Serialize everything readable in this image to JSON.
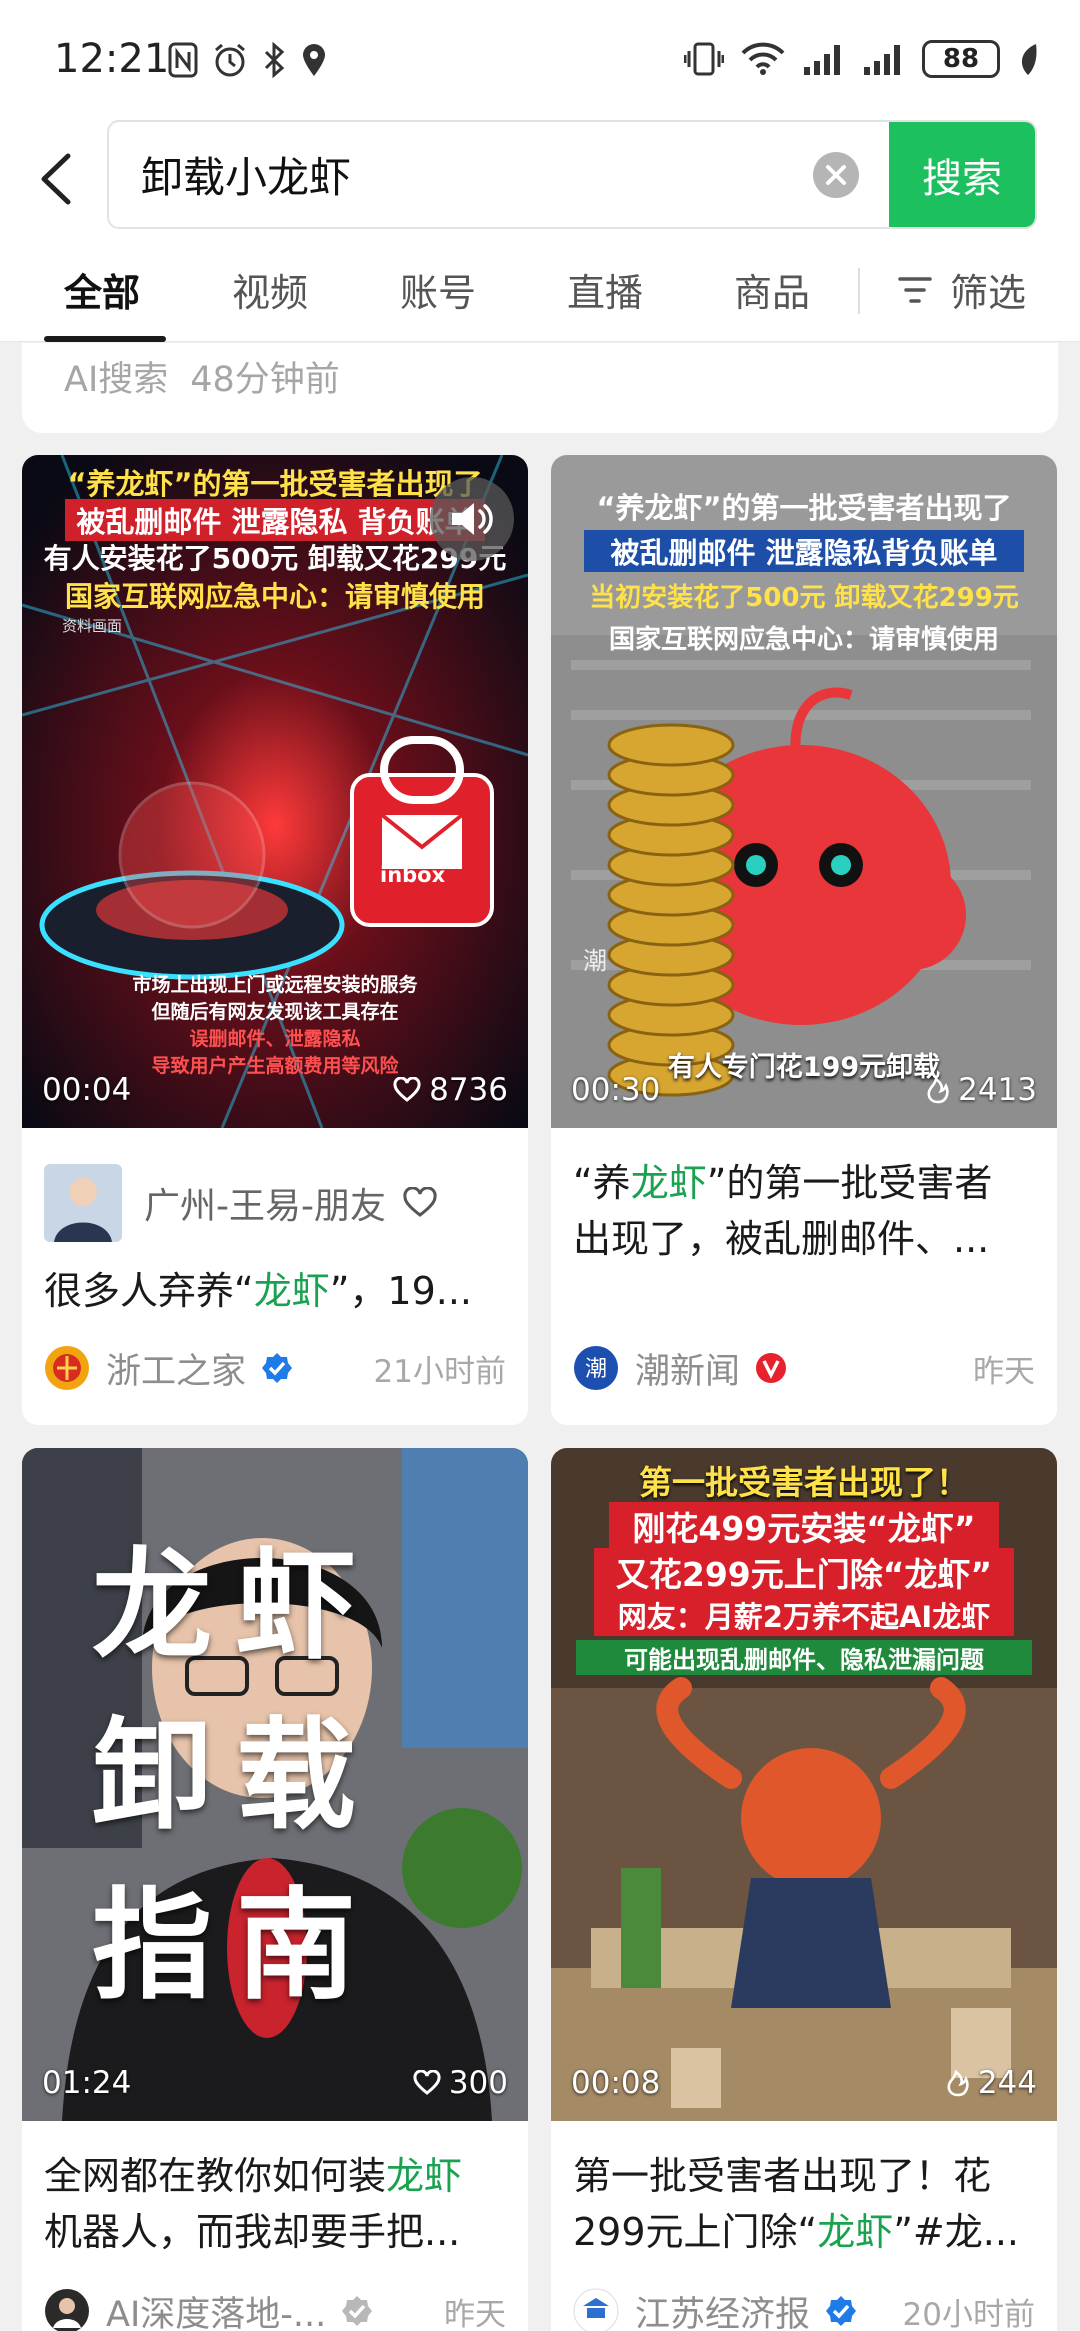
{
  "status_bar": {
    "time": "12:21",
    "battery": "88",
    "icons": [
      "nfc-icon",
      "alarm-icon",
      "bluetooth-icon",
      "location-icon",
      "vibrate-icon",
      "wifi-icon",
      "signal-icon",
      "signal-icon",
      "battery-icon",
      "leaf-icon"
    ]
  },
  "search": {
    "query": "卸载小龙虾",
    "button_label": "搜索"
  },
  "tabs": [
    {
      "label": "全部",
      "active": true
    },
    {
      "label": "视频"
    },
    {
      "label": "账号"
    },
    {
      "label": "直播"
    },
    {
      "label": "商品"
    }
  ],
  "filter_label": "筛选",
  "ai_card": {
    "label": "AI搜索",
    "time": "48分钟前"
  },
  "cards": [
    {
      "duration": "00:04",
      "stat": "8736",
      "stat_icon": "heart-icon",
      "thumb_lines": [
        "“养龙虾”的第一批受害者出现了",
        "被乱删邮件 泄露隐私 背负账单",
        "有人安装花了500元 卸载又花299元",
        "国家互联网应急中心：请审慎使用",
        "资料画面",
        "inbox",
        "市场上出现上门或远程安装的服务",
        "但随后有网友发现该工具存在",
        "误删邮件、泄露隐私",
        "导致用户产生高额费用等风险"
      ],
      "author_row": {
        "name": "广州-王易-朋友"
      },
      "title_prefix": "很多人弃养“",
      "title_highlight": "龙虾",
      "title_suffix": "”，19...",
      "source": "浙工之家",
      "time": "21小时前"
    },
    {
      "duration": "00:30",
      "stat": "2413",
      "stat_icon": "flame-icon",
      "thumb_lines": [
        "“养龙虾”的第一批受害者出现了",
        "被乱删邮件 泄露隐私背负账单",
        "当初安装花了500元 卸载又花299元",
        "国家互联网应急中心：请审慎使用",
        "有人专门花199元卸载",
        "潮"
      ],
      "title_line1_prefix": "“养",
      "title_line1_highlight": "龙虾",
      "title_line1_suffix": "”的第一批受害者",
      "title_line2": "出现了，被乱删邮件、...",
      "source": "潮新闻",
      "time": "昨天"
    },
    {
      "duration": "01:24",
      "stat": "300",
      "stat_icon": "heart-icon",
      "thumb_lines": [
        "龙虾",
        "卸载",
        "指南"
      ],
      "title_line1_prefix": "全网都在教你如何装",
      "title_line1_highlight": "龙虾",
      "title_line2": "机器人，而我却要手把...",
      "source": "AI深度落地-...",
      "time": "昨天"
    },
    {
      "duration": "00:08",
      "stat": "244",
      "stat_icon": "flame-icon",
      "thumb_lines": [
        "第一批受害者出现了！",
        "刚花499元安装“龙虾”",
        "又花299元上门除“龙虾”",
        "网友：月薪2万养不起AI龙虾",
        "可能出现乱删邮件、隐私泄漏问题"
      ],
      "title_line1": "第一批受害者出现了！花",
      "title_line2_prefix": "299元上门除“",
      "title_line2_highlight": "龙虾",
      "title_line2_suffix": "”#龙...",
      "source": "江苏经济报",
      "time": "20小时前"
    }
  ]
}
